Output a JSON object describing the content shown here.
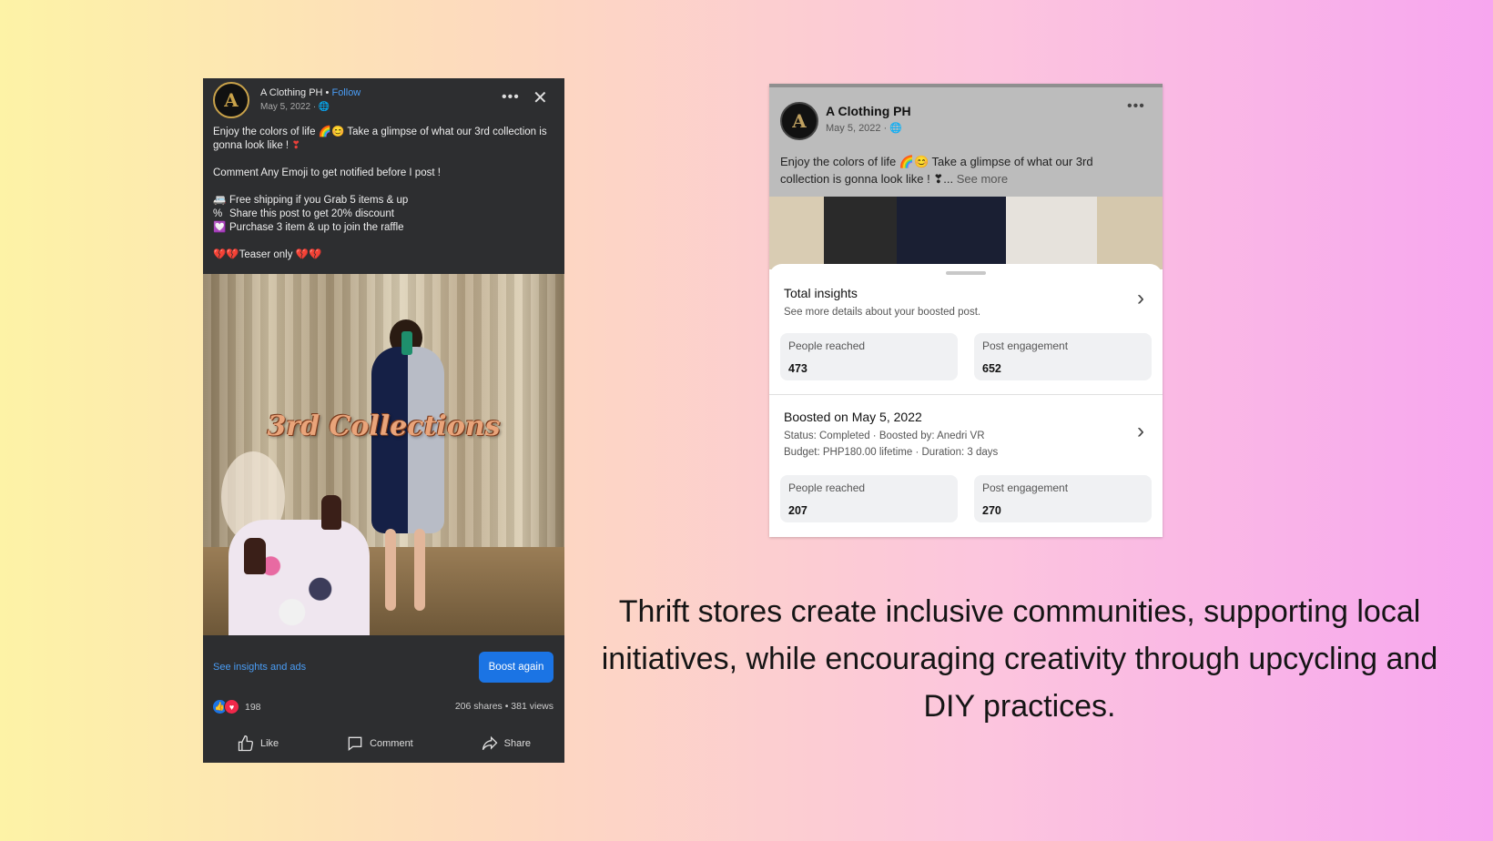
{
  "left_post": {
    "author": "A Clothing PH",
    "separator": "•",
    "follow_label": "Follow",
    "date": "May 5, 2022 · ",
    "globe": "🌐",
    "caption_line1": "Enjoy the colors of life 🌈😊 Take a glimpse of what our 3rd collection is gonna look like ! ",
    "caption_heart": "❣",
    "caption_line2": "Comment Any Emoji to get notified before I post !",
    "bullets": [
      {
        "icon": "🚐",
        "text": "Free shipping if you Grab 5 items & up"
      },
      {
        "icon": "%",
        "text": "Share this post to get 20% discount"
      },
      {
        "icon": "💟",
        "text": "Purchase 3 item & up to join the raffle"
      }
    ],
    "teaser": "💔💔Teaser only 💔💔",
    "image_title": "3rd Collections",
    "insights_link": "See insights and ads",
    "boost_label": "Boost again",
    "reaction_count": "198",
    "stats": "206 shares • 381 views",
    "actions": {
      "like": "Like",
      "comment": "Comment",
      "share": "Share"
    }
  },
  "right_card": {
    "author": "A Clothing PH",
    "date": "May 5, 2022 · ",
    "globe": "🌐",
    "caption": "Enjoy the colors of life 🌈😊 Take a glimpse of what our 3rd collection is gonna look like ! ❣... ",
    "see_more": "See more",
    "total_insights": {
      "title": "Total insights",
      "subtitle": "See more details about your boosted post.",
      "metrics": [
        {
          "label": "People reached",
          "value": "473"
        },
        {
          "label": "Post engagement",
          "value": "652"
        }
      ]
    },
    "boost": {
      "title": "Boosted on May 5, 2022",
      "status": "Status: Completed · Boosted by: Anedri VR",
      "budget": "Budget: PHP180.00 lifetime · Duration: 3 days",
      "metrics": [
        {
          "label": "People reached",
          "value": "207"
        },
        {
          "label": "Post engagement",
          "value": "270"
        }
      ]
    }
  },
  "headline": "Thrift stores create inclusive communities, supporting local initiatives,  while encouraging creativity through upcycling and DIY practices."
}
